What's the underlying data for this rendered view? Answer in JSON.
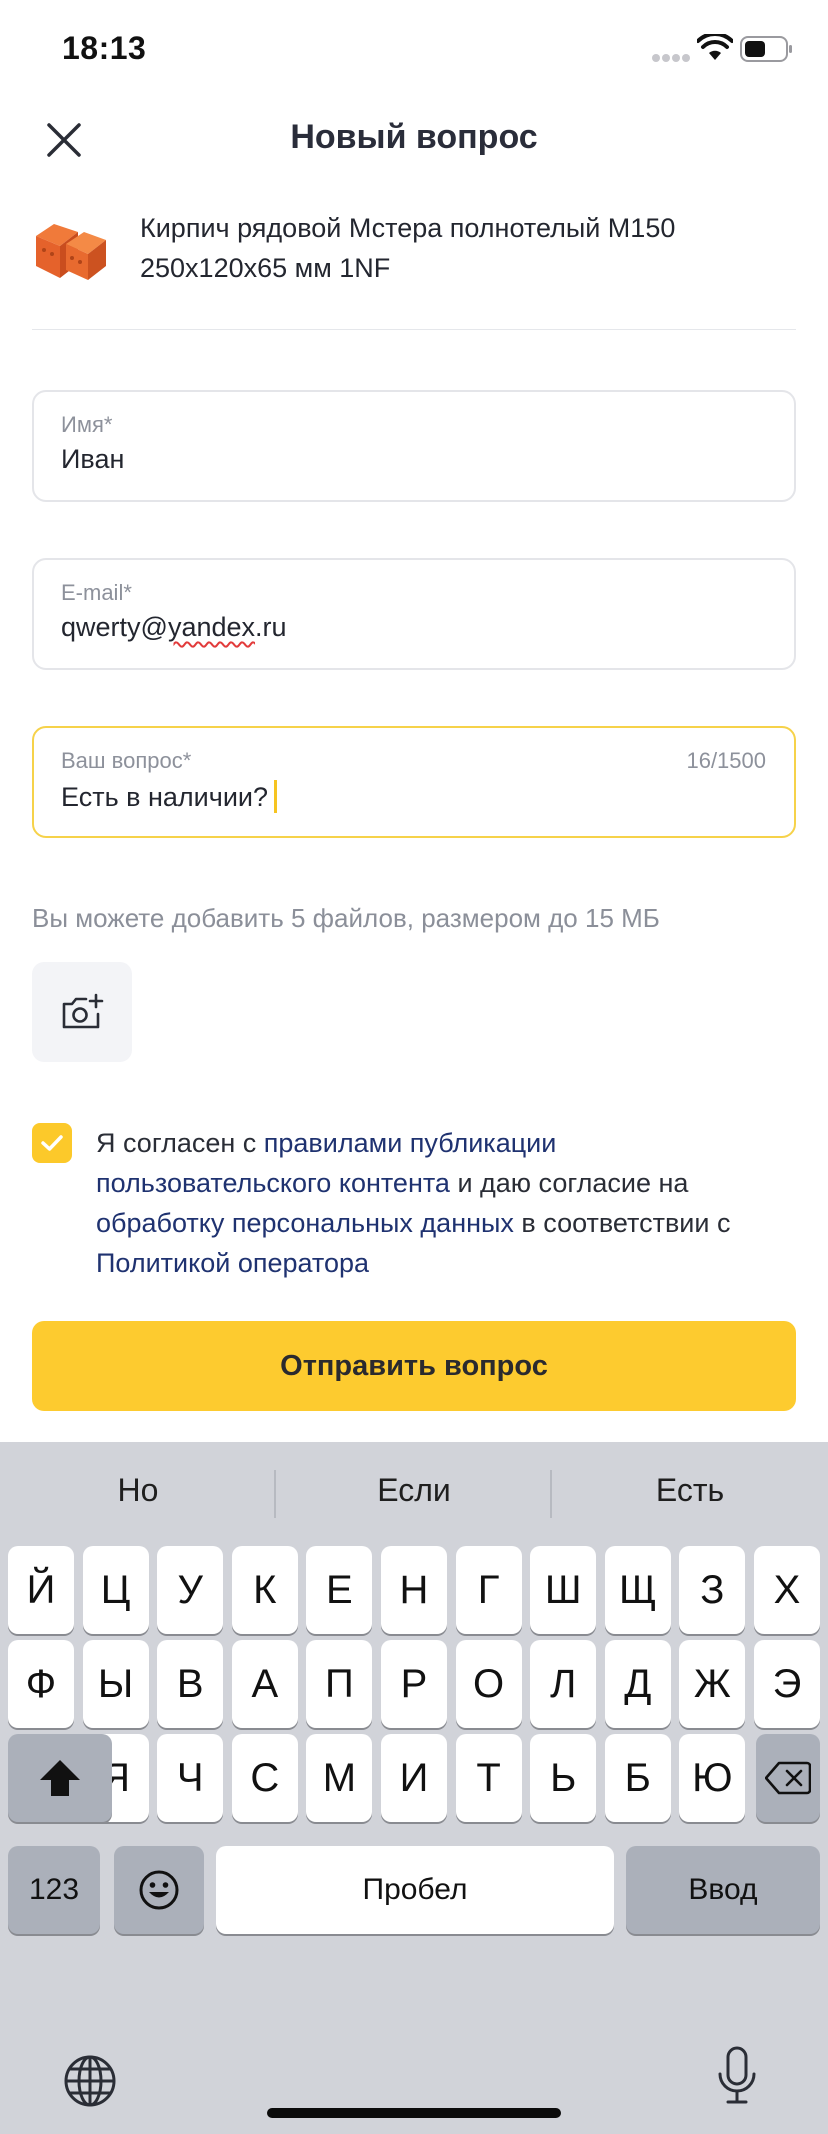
{
  "status_bar": {
    "time": "18:13"
  },
  "header": {
    "title": "Новый вопрос"
  },
  "product": {
    "name": "Кирпич рядовой Мстера полнотелый М150 250х120х65 мм 1NF"
  },
  "form": {
    "name": {
      "label": "Имя*",
      "value": "Иван"
    },
    "email": {
      "label": "E-mail*",
      "value_prefix": "qwerty@",
      "value_misspelled": "yandex",
      "value_suffix": ".ru"
    },
    "question": {
      "label": "Ваш вопрос*",
      "value": "Есть в наличии?",
      "counter": "16/1500"
    }
  },
  "attachments": {
    "hint": "Вы можете добавить 5 файлов, размером до 15 МБ"
  },
  "consent": {
    "checked": true,
    "text_1": "Я согласен с ",
    "link_1": "правилами публикации пользовательского контента",
    "text_2": " и даю согласие на ",
    "link_2": "обработку персональных данных",
    "text_3": " в соответствии с ",
    "link_3": "Политикой оператора"
  },
  "submit_label": "Отправить вопрос",
  "keyboard": {
    "suggestions": [
      "Но",
      "Если",
      "Есть"
    ],
    "row1": [
      "Й",
      "Ц",
      "У",
      "К",
      "Е",
      "Н",
      "Г",
      "Ш",
      "Щ",
      "З",
      "Х"
    ],
    "row2": [
      "Ф",
      "Ы",
      "В",
      "А",
      "П",
      "Р",
      "О",
      "Л",
      "Д",
      "Ж",
      "Э"
    ],
    "row3": [
      "Я",
      "Ч",
      "С",
      "М",
      "И",
      "Т",
      "Ь",
      "Б",
      "Ю"
    ],
    "numbers_label": "123",
    "space_label": "Пробел",
    "return_label": "Ввод"
  },
  "colors": {
    "accent": "#fdcb2f",
    "link": "#1f3270",
    "active_border": "#f6d24a"
  }
}
